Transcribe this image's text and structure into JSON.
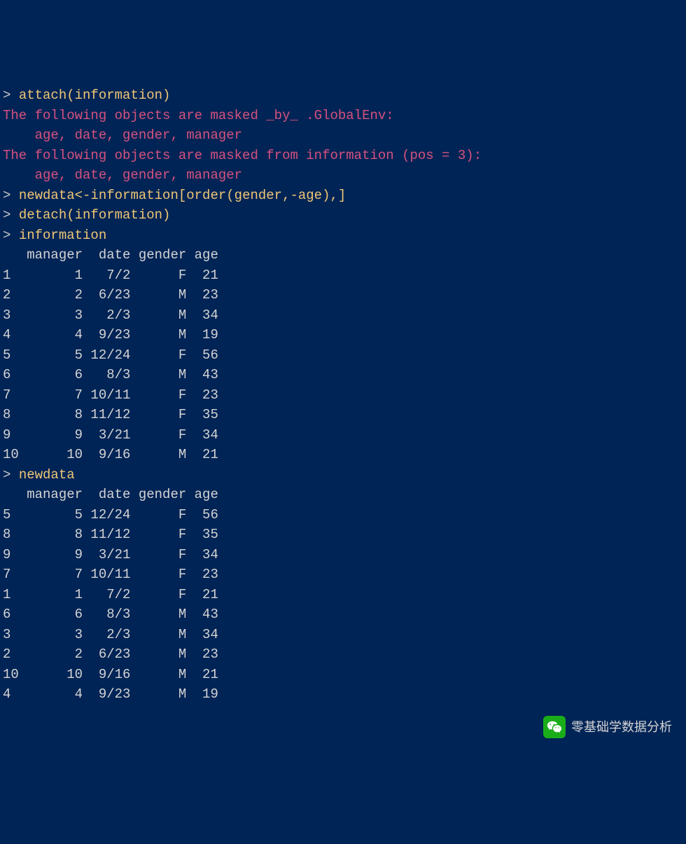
{
  "prompt": ">",
  "commands": {
    "attach": "attach(information)",
    "assign": "newdata<-information[order(gender,-age),]",
    "detach": "detach(information)",
    "print_info": "information",
    "print_newdata": "newdata"
  },
  "messages": {
    "masked_by_global": "The following objects are masked _by_ .GlobalEnv:",
    "masked_vars_1": "    age, date, gender, manager",
    "masked_from_info": "The following objects are masked from information (pos = 3):",
    "masked_vars_2": "    age, date, gender, manager"
  },
  "information": {
    "header": "   manager  date gender age",
    "rows": [
      "1        1   7/2      F  21",
      "2        2  6/23      M  23",
      "3        3   2/3      M  34",
      "4        4  9/23      M  19",
      "5        5 12/24      F  56",
      "6        6   8/3      M  43",
      "7        7 10/11      F  23",
      "8        8 11/12      F  35",
      "9        9  3/21      F  34",
      "10      10  9/16      M  21"
    ]
  },
  "newdata": {
    "header": "   manager  date gender age",
    "rows": [
      "5        5 12/24      F  56",
      "8        8 11/12      F  35",
      "9        9  3/21      F  34",
      "7        7 10/11      F  23",
      "1        1   7/2      F  21",
      "6        6   8/3      M  43",
      "3        3   2/3      M  34",
      "2        2  6/23      M  23",
      "10      10  9/16      M  21",
      "4        4  9/23      M  19"
    ]
  },
  "watermark": {
    "label": "零基础学数据分析"
  }
}
